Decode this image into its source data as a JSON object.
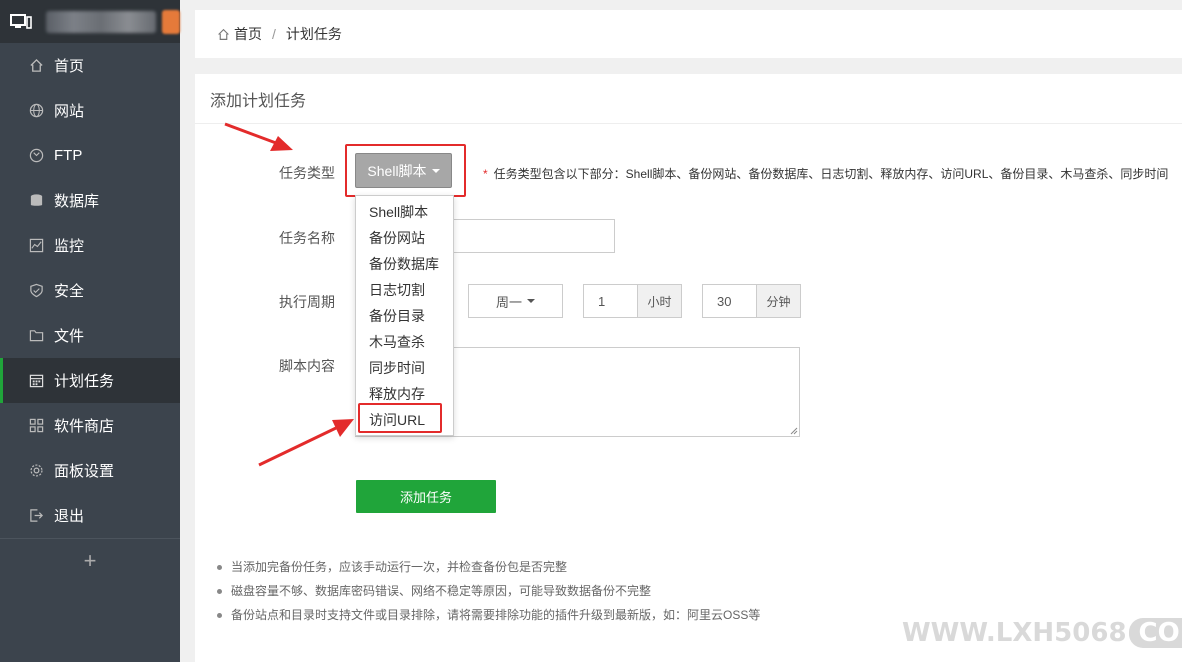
{
  "sidebar": {
    "items": [
      {
        "label": "首页",
        "icon": "home-icon"
      },
      {
        "label": "网站",
        "icon": "globe-icon"
      },
      {
        "label": "FTP",
        "icon": "ftp-icon"
      },
      {
        "label": "数据库",
        "icon": "database-icon"
      },
      {
        "label": "监控",
        "icon": "monitor-chart-icon"
      },
      {
        "label": "安全",
        "icon": "shield-icon"
      },
      {
        "label": "文件",
        "icon": "folder-icon"
      },
      {
        "label": "计划任务",
        "icon": "calendar-icon",
        "active": true
      },
      {
        "label": "软件商店",
        "icon": "grid-icon"
      },
      {
        "label": "面板设置",
        "icon": "gear-icon"
      },
      {
        "label": "退出",
        "icon": "logout-icon"
      }
    ],
    "add_symbol": "+"
  },
  "breadcrumb": {
    "home": "首页",
    "separator": "/",
    "current": "计划任务"
  },
  "panel": {
    "title": "添加计划任务"
  },
  "form": {
    "type_label": "任务类型",
    "type_value": "Shell脚本",
    "type_tip_star": "*",
    "type_tip": "任务类型包含以下部分：Shell脚本、备份网站、备份数据库、日志切割、释放内存、访问URL、备份目录、木马查杀、同步时间",
    "name_label": "任务名称",
    "name_value": "",
    "cycle_label": "执行周期",
    "week_value": "周一",
    "hour_value": "1",
    "hour_unit": "小时",
    "minute_value": "30",
    "minute_unit": "分钟",
    "script_label": "脚本内容",
    "submit": "添加任务"
  },
  "dropdown": {
    "options": [
      "Shell脚本",
      "备份网站",
      "备份数据库",
      "日志切割",
      "备份目录",
      "木马查杀",
      "同步时间",
      "释放内存",
      "访问URL"
    ],
    "highlighted": "访问URL"
  },
  "notes": [
    "当添加完备份任务，应该手动运行一次，并检查备份包是否完整",
    "磁盘容量不够、数据库密码错误、网络不稳定等原因，可能导致数据备份不完整",
    "备份站点和目录时支持文件或目录排除，请将需要排除功能的插件升级到最新版，如：阿里云OSS等"
  ],
  "watermark": {
    "main": "WWW.LXH5068",
    "suffix": "COM"
  },
  "colors": {
    "accent": "#20a53a",
    "highlight": "#e32b2b",
    "sidebar": "#3c444d"
  }
}
